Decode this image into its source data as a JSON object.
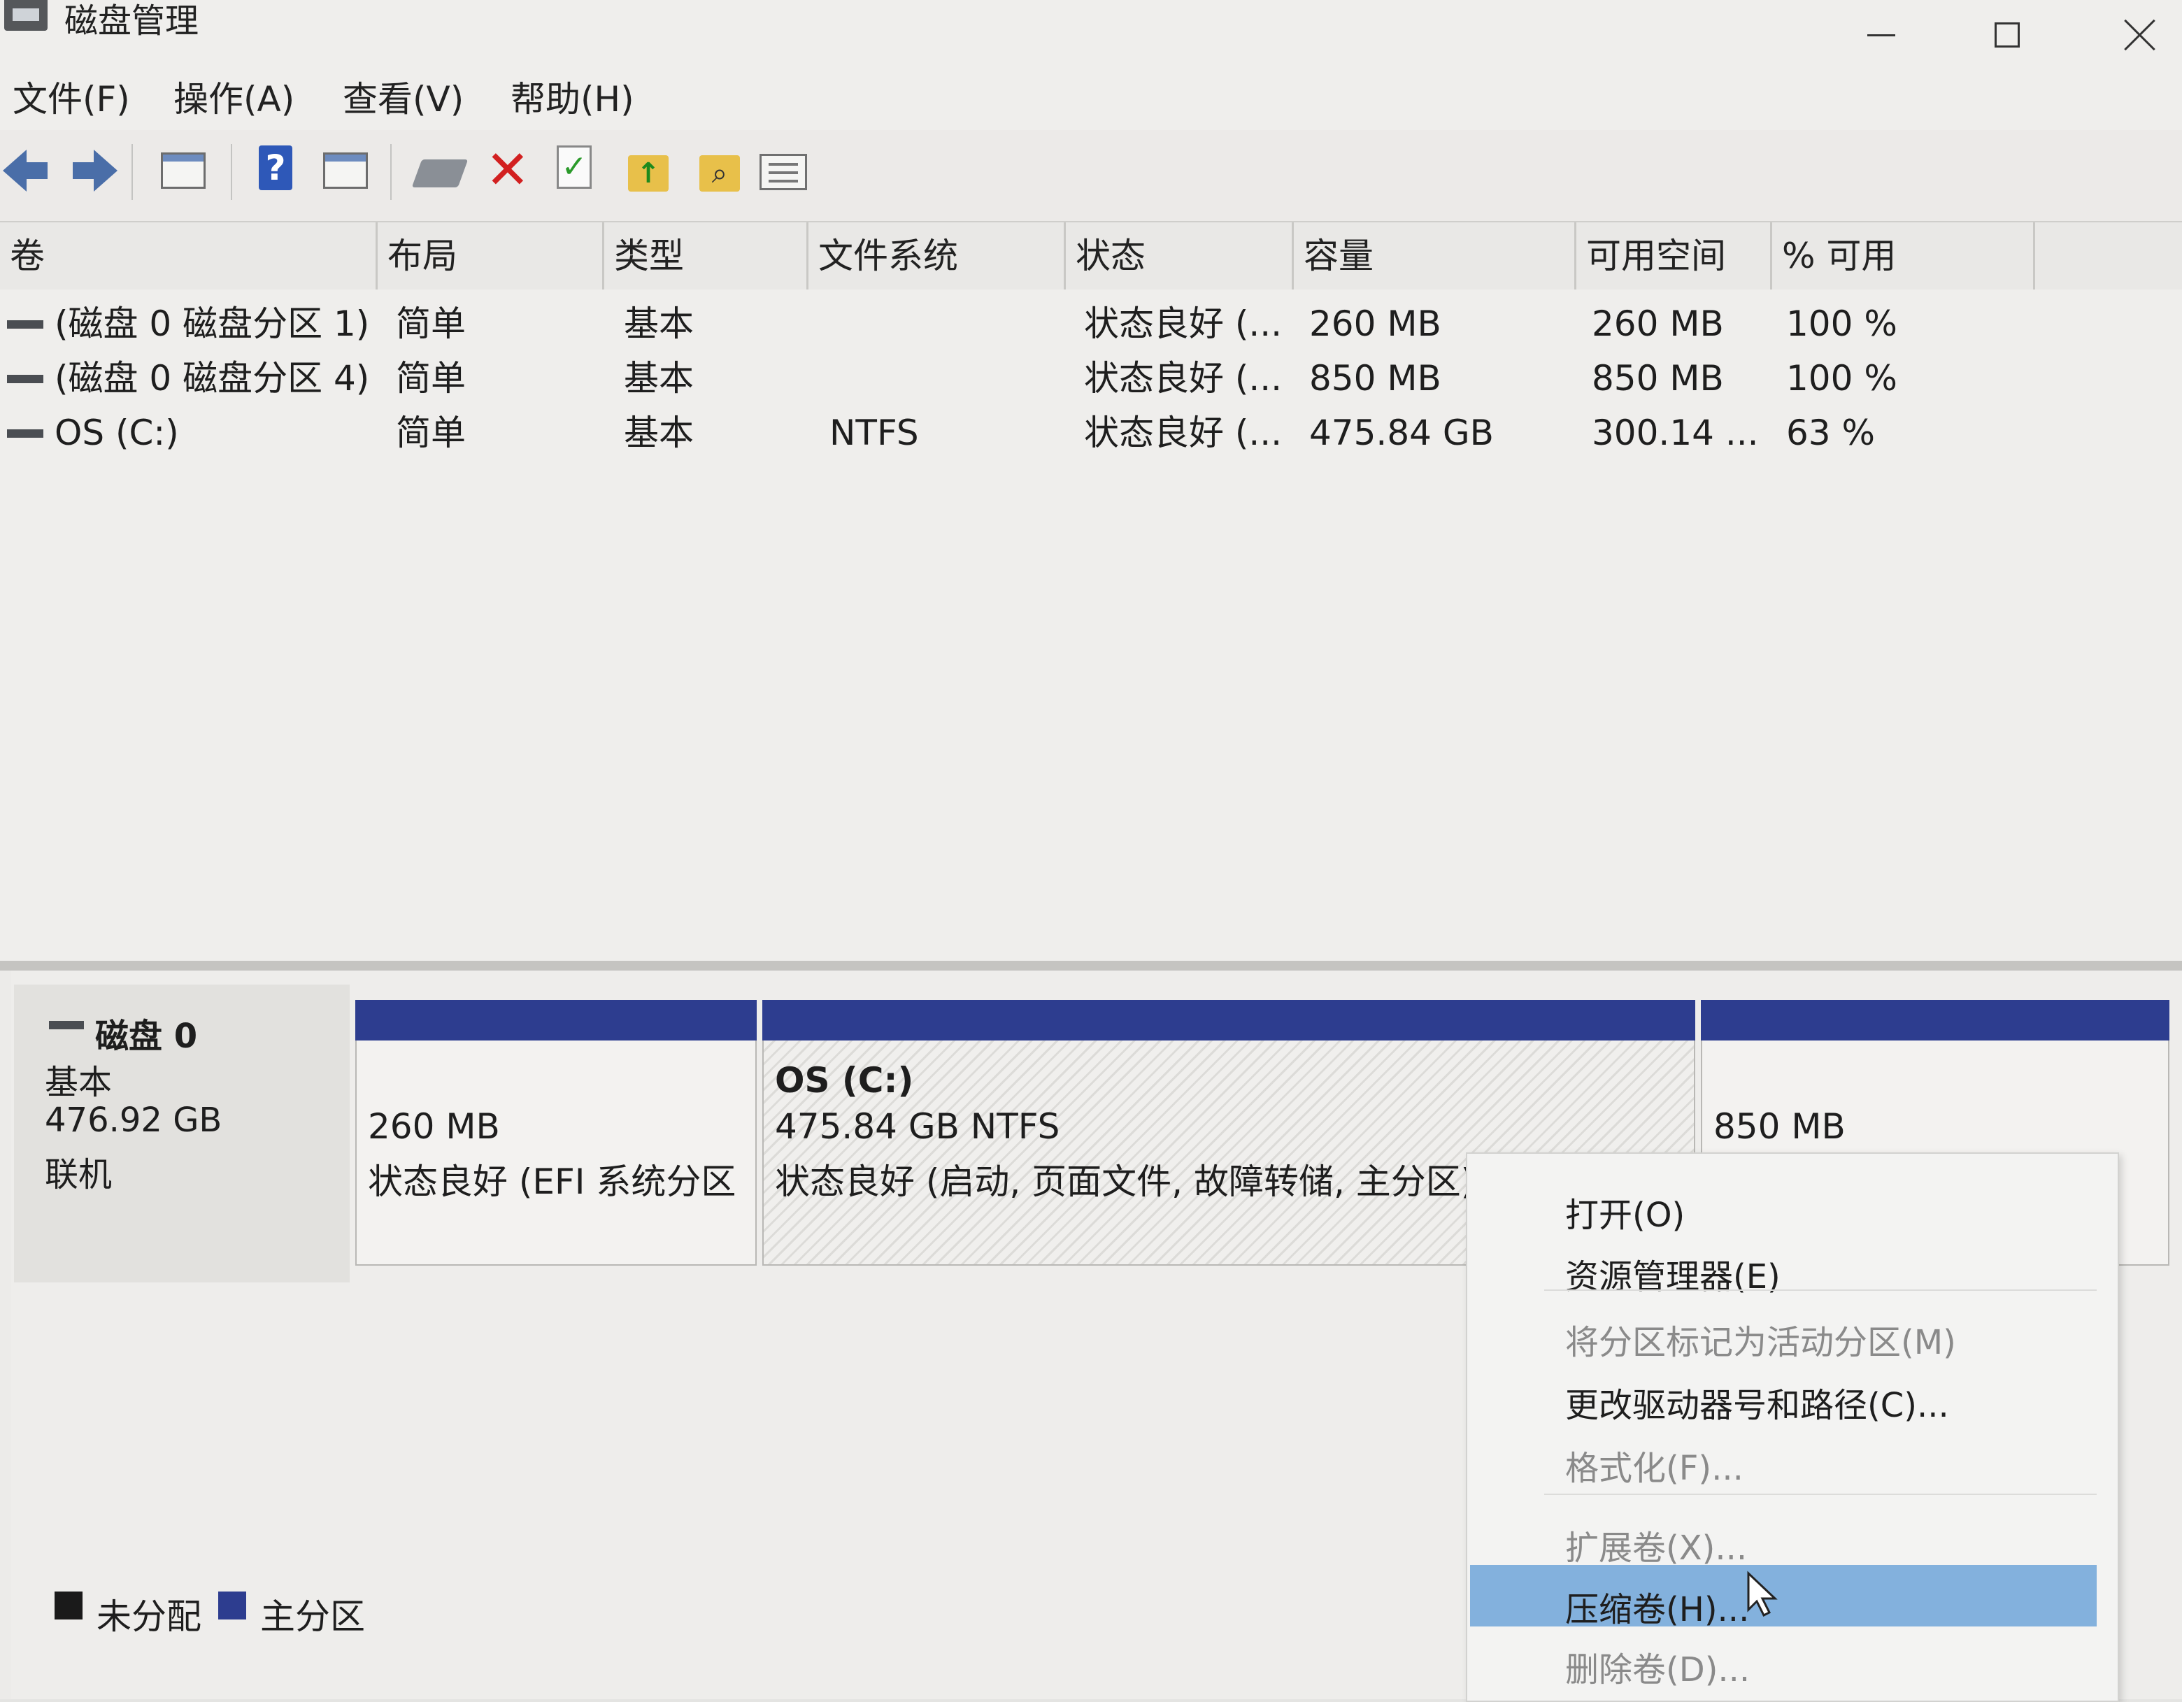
{
  "window": {
    "title": "磁盘管理"
  },
  "menu": [
    "文件(F)",
    "操作(A)",
    "查看(V)",
    "帮助(H)"
  ],
  "toolbar": {
    "icons": [
      "back-arrow-icon",
      "forward-arrow-icon",
      "console-tree-icon",
      "help-icon",
      "properties-view-icon",
      "connect-icon",
      "delete-icon",
      "check-icon",
      "folder-up-icon",
      "folder-search-icon",
      "list-view-icon"
    ]
  },
  "columns": [
    "卷",
    "布局",
    "类型",
    "文件系统",
    "状态",
    "容量",
    "可用空间",
    "% 可用"
  ],
  "volumes": [
    {
      "name": "(磁盘 0 磁盘分区 1)",
      "layout": "简单",
      "type": "基本",
      "fs": "",
      "status": "状态良好 (...",
      "capacity": "260 MB",
      "free": "260 MB",
      "pct": "100 %"
    },
    {
      "name": "(磁盘 0 磁盘分区 4)",
      "layout": "简单",
      "type": "基本",
      "fs": "",
      "status": "状态良好 (...",
      "capacity": "850 MB",
      "free": "850 MB",
      "pct": "100 %"
    },
    {
      "name": "OS (C:)",
      "layout": "简单",
      "type": "基本",
      "fs": "NTFS",
      "status": "状态良好 (...",
      "capacity": "475.84 GB",
      "free": "300.14 ...",
      "pct": "63 %"
    }
  ],
  "disk": {
    "name": "磁盘 0",
    "type": "基本",
    "size": "476.92 GB",
    "state": "联机"
  },
  "partitions": [
    {
      "size": "260 MB",
      "status": "状态良好 (EFI 系统分区"
    },
    {
      "label": "OS  (C:)",
      "size": "475.84 GB NTFS",
      "status": "状态良好 (启动, 页面文件, 故障转储, 主分区)"
    },
    {
      "size": "850 MB"
    }
  ],
  "legend": [
    {
      "label": "未分配",
      "color": "#1a1a1a"
    },
    {
      "label": "主分区",
      "color": "#2d3d8f"
    }
  ],
  "context_menu": {
    "open": "打开(O)",
    "explore": "资源管理器(E)",
    "mark_active": "将分区标记为活动分区(M)",
    "change_letter": "更改驱动器号和路径(C)...",
    "format": "格式化(F)...",
    "extend": "扩展卷(X)...",
    "shrink": "压缩卷(H)...",
    "delete": "删除卷(D)..."
  },
  "colors": {
    "primary_partition": "#2d3d8f",
    "menu_highlight": "#83b1dd"
  }
}
